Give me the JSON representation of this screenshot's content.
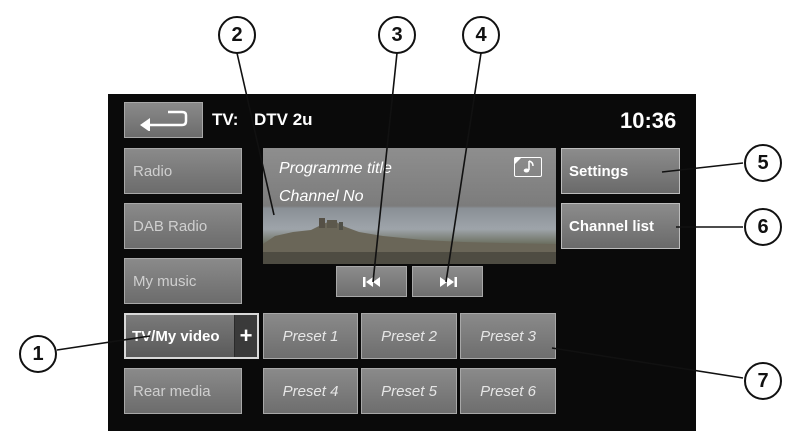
{
  "header": {
    "source_label": "TV:",
    "channel": "DTV 2u",
    "clock": "10:36"
  },
  "sidebar": {
    "items": [
      {
        "label": "Radio"
      },
      {
        "label": "DAB Radio"
      },
      {
        "label": "My music"
      },
      {
        "label": "TV/My video",
        "expand": "+"
      },
      {
        "label": "Rear media"
      }
    ]
  },
  "info_panel": {
    "programme_title": "Programme title",
    "channel_no": "Channel No"
  },
  "right_buttons": {
    "settings": "Settings",
    "channel_list": "Channel list"
  },
  "presets": [
    "Preset 1",
    "Preset 2",
    "Preset 3",
    "Preset 4",
    "Preset 5",
    "Preset 6"
  ],
  "callouts": [
    "1",
    "2",
    "3",
    "4",
    "5",
    "6",
    "7"
  ],
  "icons": {
    "back": "back-arrow-icon",
    "music": "music-note-icon",
    "previous": "skip-previous-icon",
    "next": "skip-next-icon"
  }
}
